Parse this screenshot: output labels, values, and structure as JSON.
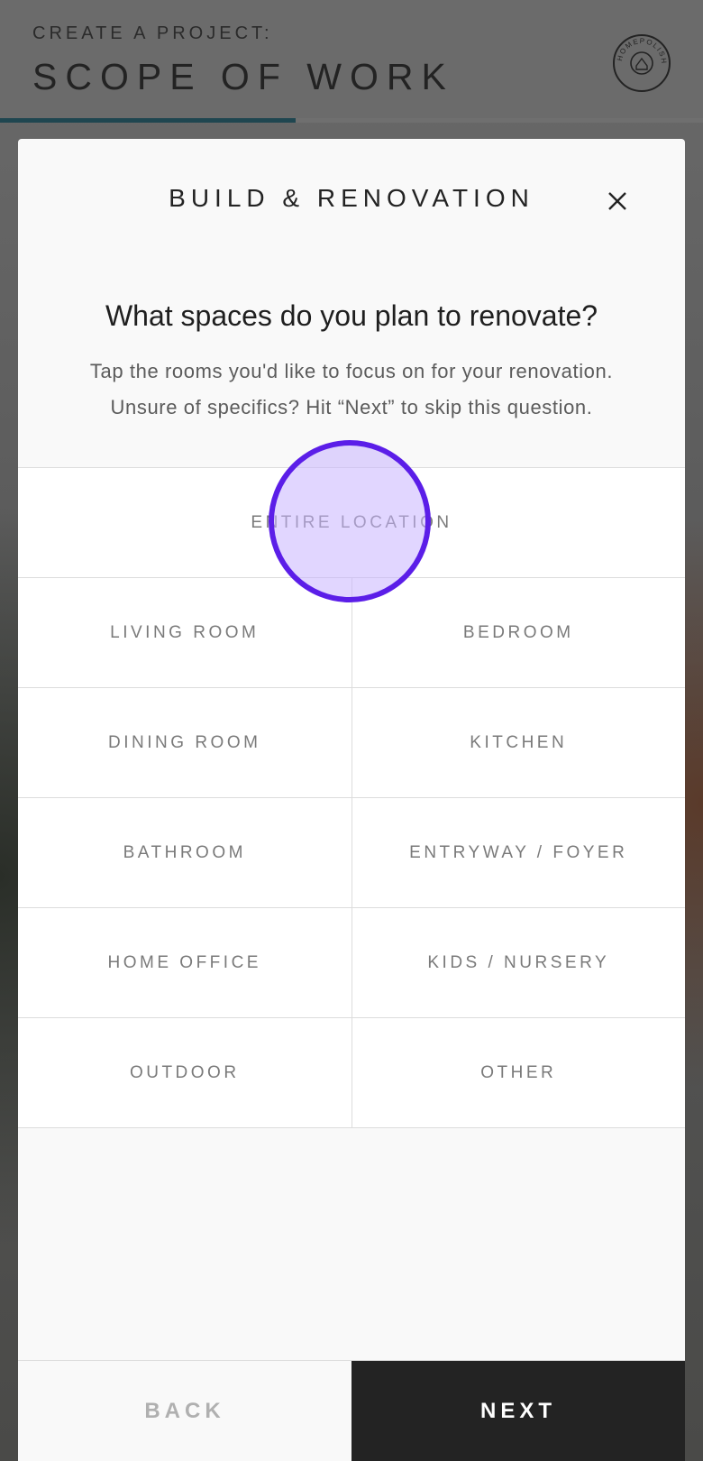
{
  "header": {
    "kicker": "CREATE A PROJECT:",
    "title": "SCOPE OF WORK",
    "progress_fraction": 0.42,
    "logo_text": "HOMEPOLISH",
    "progress_color": "#1f4650"
  },
  "modal": {
    "title": "BUILD & RENOVATION",
    "close_icon": "close-icon",
    "question": "What spaces do you plan to renovate?",
    "subtext_line1": "Tap the rooms you'd like to focus on for your renovation.",
    "subtext_line2": "Unsure of specifics? Hit “Next” to skip this question."
  },
  "options": {
    "full": "ENTIRE LOCATION",
    "rows": [
      [
        "LIVING ROOM",
        "BEDROOM"
      ],
      [
        "DINING ROOM",
        "KITCHEN"
      ],
      [
        "BATHROOM",
        "ENTRYWAY / FOYER"
      ],
      [
        "HOME OFFICE",
        "KIDS / NURSERY"
      ],
      [
        "OUTDOOR",
        "OTHER"
      ]
    ]
  },
  "footer": {
    "back_label": "BACK",
    "next_label": "NEXT"
  },
  "colors": {
    "touch_indicator": "#5b1ee8",
    "next_background": "#232323"
  }
}
